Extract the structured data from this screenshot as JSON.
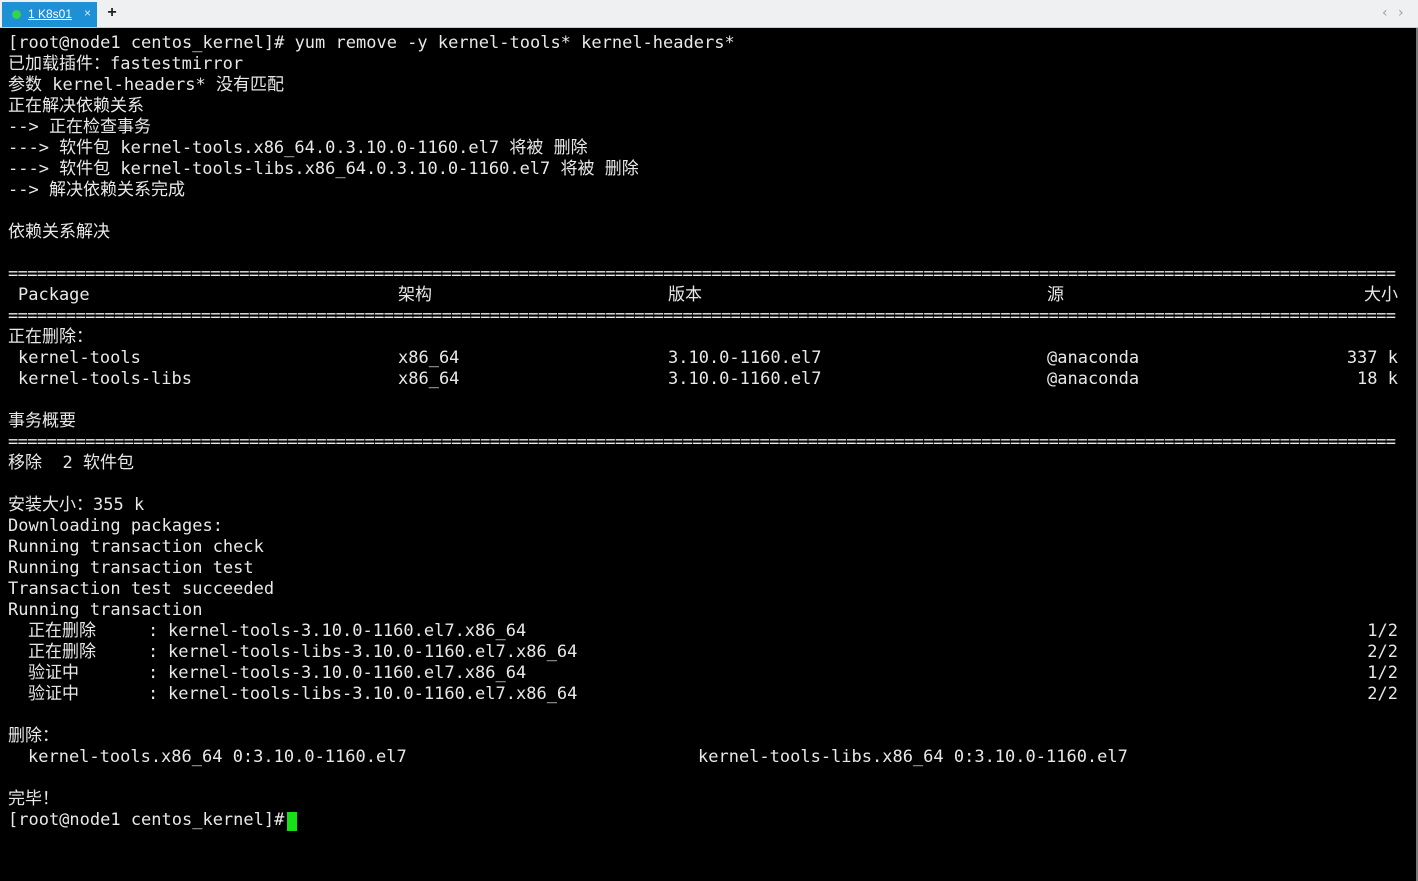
{
  "tab": {
    "label": "1 K8s01",
    "close": "×"
  },
  "new_tab": "+",
  "nav": {
    "prev": "‹",
    "next": "›"
  },
  "lines": {
    "l1": "[root@node1 centos_kernel]# yum remove -y kernel-tools* kernel-headers*",
    "l2": "已加载插件：fastestmirror",
    "l3": "参数 kernel-headers* 没有匹配",
    "l4": "正在解决依赖关系",
    "l5": "--> 正在检查事务",
    "l6": "---> 软件包 kernel-tools.x86_64.0.3.10.0-1160.el7 将被 删除",
    "l7": "---> 软件包 kernel-tools-libs.x86_64.0.3.10.0-1160.el7 将被 删除",
    "l8": "--> 解决依赖关系完成",
    "l9": "依赖关系解决",
    "removing_header": "正在删除：",
    "summary": "事务概要",
    "remove_count": "移除  2 软件包",
    "install_size": "安装大小：355 k",
    "downloading": "Downloading packages:",
    "check": "Running transaction check",
    "test": "Running transaction test",
    "succeeded": "Transaction test succeeded",
    "running": "Running transaction",
    "removed_header": "删除：",
    "done": "完毕！",
    "prompt": "[root@node1 centos_kernel]#"
  },
  "separator": "================================================================================================================================================",
  "table": {
    "headers": {
      "package": "Package",
      "arch": "架构",
      "version": "版本",
      "repo": "源",
      "size": "大小"
    },
    "rows": [
      {
        "package": "kernel-tools",
        "arch": "x86_64",
        "version": "3.10.0-1160.el7",
        "repo": "@anaconda",
        "size": "337 k"
      },
      {
        "package": "kernel-tools-libs",
        "arch": "x86_64",
        "version": "3.10.0-1160.el7",
        "repo": "@anaconda",
        "size": "18 k"
      }
    ]
  },
  "progress": [
    {
      "action": "正在删除",
      "sep": ":",
      "pkg": "kernel-tools-3.10.0-1160.el7.x86_64",
      "count": "1/2"
    },
    {
      "action": "正在删除",
      "sep": ":",
      "pkg": "kernel-tools-libs-3.10.0-1160.el7.x86_64",
      "count": "2/2"
    },
    {
      "action": "验证中",
      "sep": ":",
      "pkg": "kernel-tools-3.10.0-1160.el7.x86_64",
      "count": "1/2"
    },
    {
      "action": "验证中",
      "sep": ":",
      "pkg": "kernel-tools-libs-3.10.0-1160.el7.x86_64",
      "count": "2/2"
    }
  ],
  "removed": [
    "kernel-tools.x86_64 0:3.10.0-1160.el7",
    "kernel-tools-libs.x86_64 0:3.10.0-1160.el7"
  ]
}
